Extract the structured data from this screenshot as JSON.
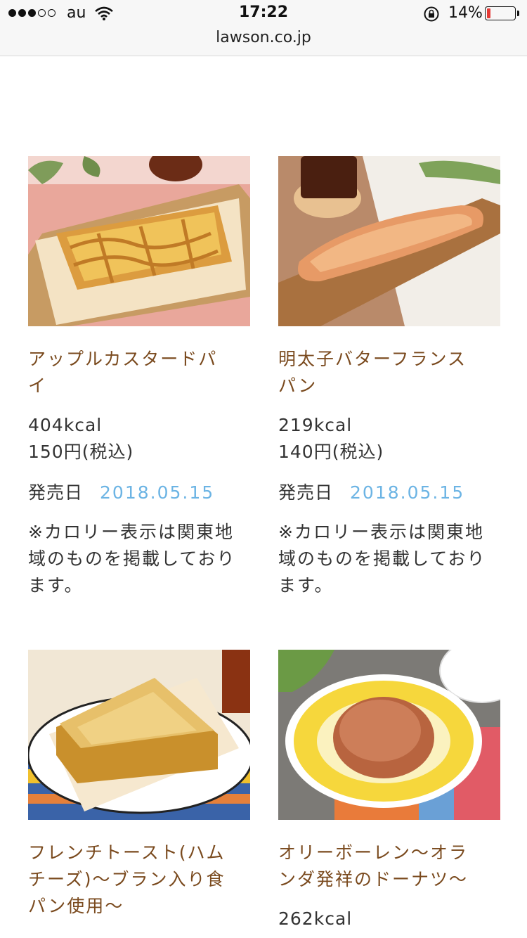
{
  "status_bar": {
    "carrier": "au",
    "time": "17:22",
    "url": "lawson.co.jp",
    "battery": "14%",
    "battery_level": 0.14
  },
  "products": [
    {
      "name": "アップルカスタードパイ",
      "kcal": "404kcal",
      "price": "150円(税込)",
      "release_label": "発売日",
      "release_date": "2018.05.15",
      "note": "※カロリー表示は関東地域のものを掲載しております。"
    },
    {
      "name": "明太子バターフランスパン",
      "kcal": "219kcal",
      "price": "140円(税込)",
      "release_label": "発売日",
      "release_date": "2018.05.15",
      "note": "※カロリー表示は関東地域のものを掲載しております。"
    },
    {
      "name": "フレンチトースト(ハムチーズ)〜ブラン入り食パン使用〜"
    },
    {
      "name": "オリーボーレン〜オランダ発祥のドーナツ〜",
      "kcal": "262kcal"
    }
  ]
}
